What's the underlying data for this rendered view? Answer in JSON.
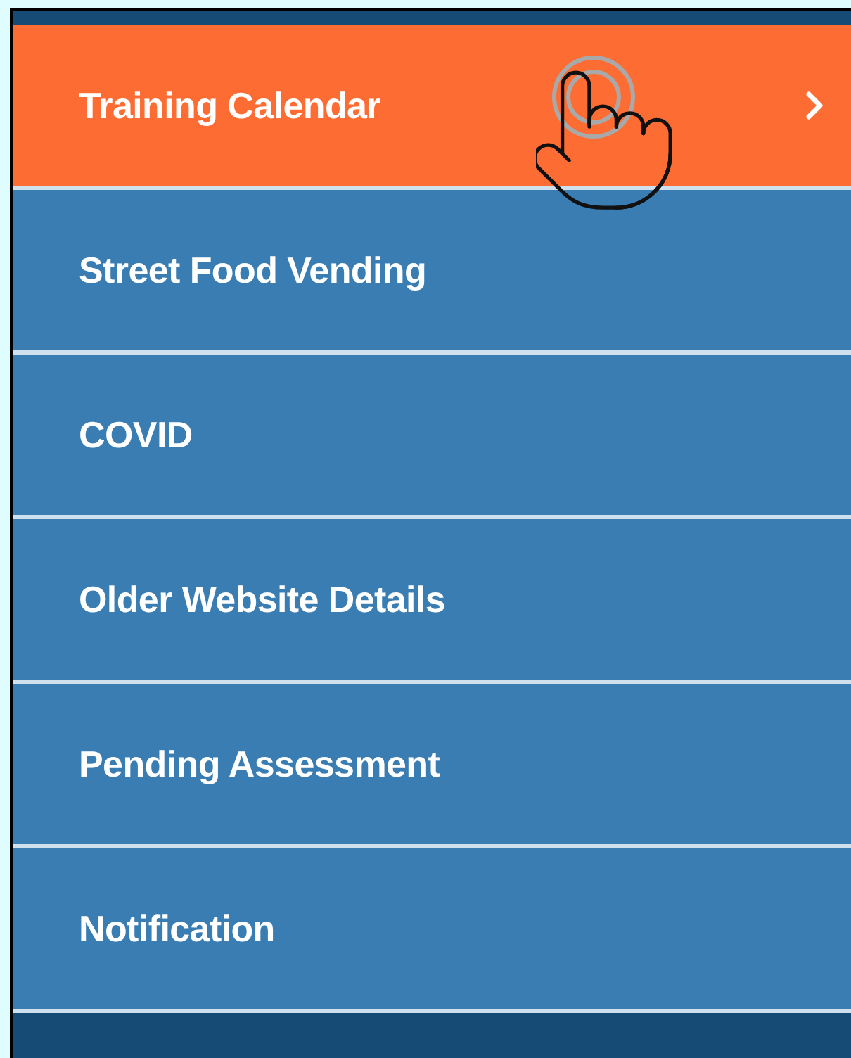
{
  "menu": {
    "items": [
      {
        "label": "Training Calendar",
        "selected": true
      },
      {
        "label": "Street Food Vending",
        "selected": false
      },
      {
        "label": "COVID",
        "selected": false
      },
      {
        "label": "Older Website Details",
        "selected": false
      },
      {
        "label": "Pending Assessment",
        "selected": false
      },
      {
        "label": "Notification",
        "selected": false
      }
    ]
  }
}
